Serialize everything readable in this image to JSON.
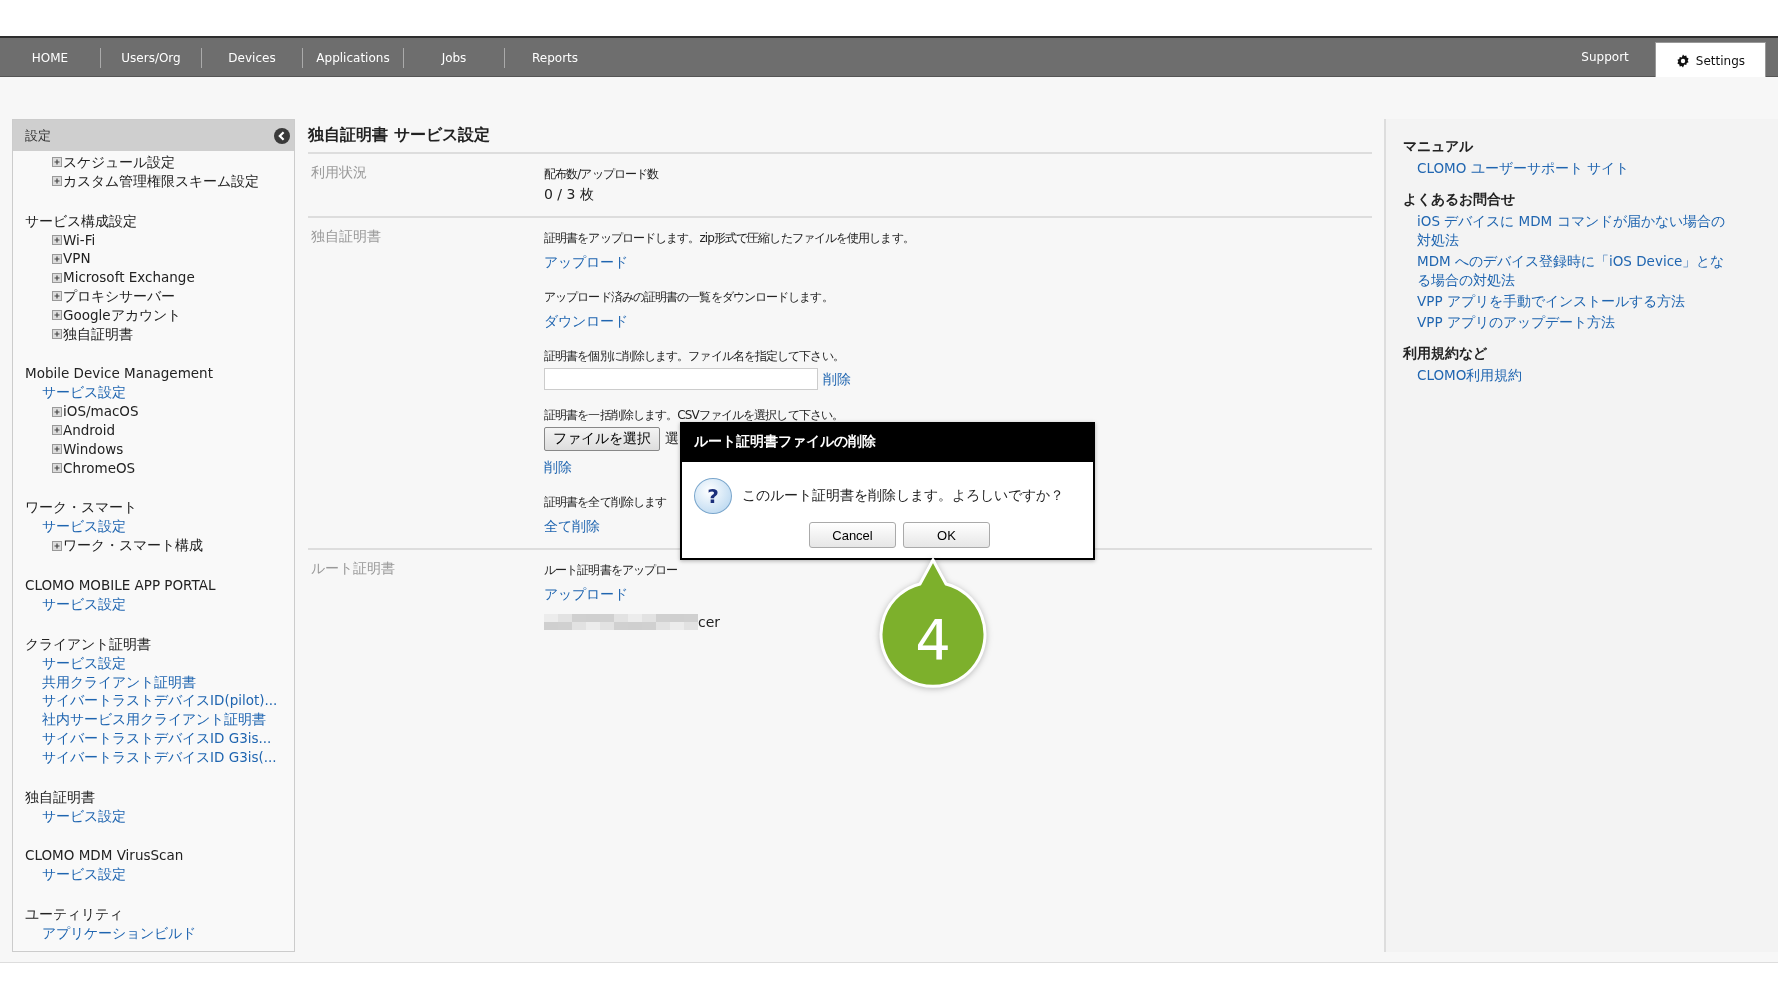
{
  "nav": {
    "items": [
      {
        "label": "HOME",
        "selected": false
      },
      {
        "label": "Users/Org",
        "selected": false
      },
      {
        "label": "Devices",
        "selected": false
      },
      {
        "label": "Applications",
        "selected": false
      },
      {
        "label": "Jobs",
        "selected": false
      },
      {
        "label": "Reports",
        "selected": false
      }
    ],
    "right_items": [
      {
        "label": "Support",
        "kind": "plain",
        "selected": false
      },
      {
        "label": "Settings",
        "kind": "gear",
        "selected": true
      }
    ]
  },
  "sidebar": {
    "title": "設定",
    "groups": [
      {
        "items": [
          {
            "kind": "expand",
            "label": "スケジュール設定"
          },
          {
            "kind": "expand",
            "label": "カスタム管理権限スキーム設定"
          }
        ]
      },
      {
        "title": "サービス構成設定",
        "items": [
          {
            "kind": "expand",
            "label": "Wi-Fi"
          },
          {
            "kind": "expand",
            "label": "VPN"
          },
          {
            "kind": "expand",
            "label": "Microsoft Exchange"
          },
          {
            "kind": "expand",
            "label": "プロキシサーバー"
          },
          {
            "kind": "expand",
            "label": "Googleアカウント"
          },
          {
            "kind": "expand",
            "label": "独自証明書"
          }
        ]
      },
      {
        "title": "Mobile Device Management",
        "items": [
          {
            "kind": "link",
            "label": "サービス設定"
          },
          {
            "kind": "expand",
            "label": "iOS/macOS"
          },
          {
            "kind": "expand",
            "label": "Android"
          },
          {
            "kind": "expand",
            "label": "Windows"
          },
          {
            "kind": "expand",
            "label": "ChromeOS"
          }
        ]
      },
      {
        "title": "ワーク・スマート",
        "items": [
          {
            "kind": "link",
            "label": "サービス設定"
          },
          {
            "kind": "expand",
            "label": "ワーク・スマート構成"
          }
        ]
      },
      {
        "title": "CLOMO MOBILE APP PORTAL",
        "items": [
          {
            "kind": "link",
            "label": "サービス設定"
          }
        ]
      },
      {
        "title": "クライアント証明書",
        "items": [
          {
            "kind": "link",
            "label": "サービス設定"
          },
          {
            "kind": "link",
            "label": "共用クライアント証明書"
          },
          {
            "kind": "link",
            "label": "サイバートラストデバイスID(pilot)..."
          },
          {
            "kind": "link",
            "label": "社内サービス用クライアント証明書"
          },
          {
            "kind": "link",
            "label": "サイバートラストデバイスID G3is..."
          },
          {
            "kind": "link",
            "label": "サイバートラストデバイスID G3is(..."
          }
        ]
      },
      {
        "title": "独自証明書",
        "items": [
          {
            "kind": "link",
            "label": "サービス設定"
          }
        ]
      },
      {
        "title": "CLOMO MDM VirusScan",
        "items": [
          {
            "kind": "link",
            "label": "サービス設定"
          }
        ]
      },
      {
        "title": "ユーティリティ",
        "items": [
          {
            "kind": "link",
            "label": "アプリケーションビルド"
          }
        ]
      }
    ]
  },
  "main": {
    "title": "独自証明書 サービス設定",
    "sections": [
      {
        "label": "利用状況",
        "blocks": [
          {
            "kind": "desc",
            "text": "配布数/アップロード数"
          },
          {
            "kind": "value",
            "text": "0 / 3 枚"
          }
        ]
      },
      {
        "label": "独自証明書",
        "blocks": [
          {
            "kind": "desc",
            "text": "証明書をアップロードします。zip形式で圧縮したファイルを使用します。"
          },
          {
            "kind": "link",
            "text": "アップロード"
          },
          {
            "kind": "desc",
            "text": "アップロード済みの証明書の一覧をダウンロードします。"
          },
          {
            "kind": "link",
            "text": "ダウンロード"
          },
          {
            "kind": "desc",
            "text": "証明書を個別に削除します。ファイル名を指定して下さい。"
          },
          {
            "kind": "field",
            "link": "削除"
          },
          {
            "kind": "desc",
            "text": "証明書を一括削除します。CSVファイルを選択して下さい。"
          },
          {
            "kind": "file",
            "button": "ファイルを選択",
            "note": "選"
          },
          {
            "kind": "link",
            "text": "削除"
          },
          {
            "kind": "desc",
            "text": "証明書を全て削除します"
          },
          {
            "kind": "link",
            "text": "全て削除"
          }
        ]
      },
      {
        "label": "ルート証明書",
        "blocks": [
          {
            "kind": "desc",
            "text": "ルート証明書をアップロー"
          },
          {
            "kind": "link",
            "text": "アップロード"
          },
          {
            "kind": "file_name",
            "text": "cer"
          }
        ]
      }
    ]
  },
  "help": {
    "sections": [
      {
        "title": "マニュアル",
        "links": [
          "CLOMO ユーザーサポート サイト"
        ]
      },
      {
        "title": "よくあるお問合せ",
        "links": [
          "iOS デバイスに MDM コマンドが届かない場合の対処法",
          "MDM へのデバイス登録時に「iOS Device」となる場合の対処法",
          "VPP アプリを手動でインストールする方法",
          "VPP アプリのアップデート方法"
        ]
      },
      {
        "title": "利用規約など",
        "links": [
          "CLOMO利用規約"
        ]
      }
    ]
  },
  "dialog": {
    "title": "ルート証明書ファイルの削除",
    "icon_glyph": "?",
    "message": "このルート証明書を削除します。よろしいですか？",
    "buttons": [
      "Cancel",
      "OK"
    ]
  },
  "callout": {
    "label": "4"
  }
}
